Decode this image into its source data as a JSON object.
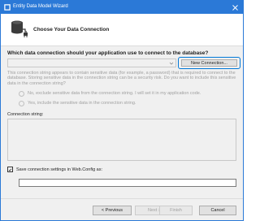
{
  "window": {
    "title": "Entity Data Model Wizard",
    "accent_color": "#2b79d7"
  },
  "header": {
    "title": "Choose Your Data Connection",
    "icon": "database-plug-icon"
  },
  "main": {
    "question": "Which data connection should your application use to connect to the database?",
    "connection_dropdown_value": "",
    "new_connection_label": "New Connection...",
    "warning_text": "This connection string appears to contain sensitive data (for example, a password) that is required to connect to the database. Storing sensitive data in the connection string can be a security risk. Do you want to include this sensitive data in the connection string?",
    "radio_options": [
      {
        "label": "No, exclude sensitive data from the connection string. I will set it in my application code.",
        "selected": false
      },
      {
        "label": "Yes, include the sensitive data in the connection string.",
        "selected": false
      }
    ],
    "connection_string_label": "Connection string:",
    "connection_string_value": "",
    "save_settings_label": "Save connection settings in Web.Config as:",
    "save_settings_checked": true,
    "config_name_value": ""
  },
  "footer": {
    "previous_label": "< Previous",
    "next_label": "Next >",
    "finish_label": "Finish",
    "cancel_label": "Cancel"
  }
}
